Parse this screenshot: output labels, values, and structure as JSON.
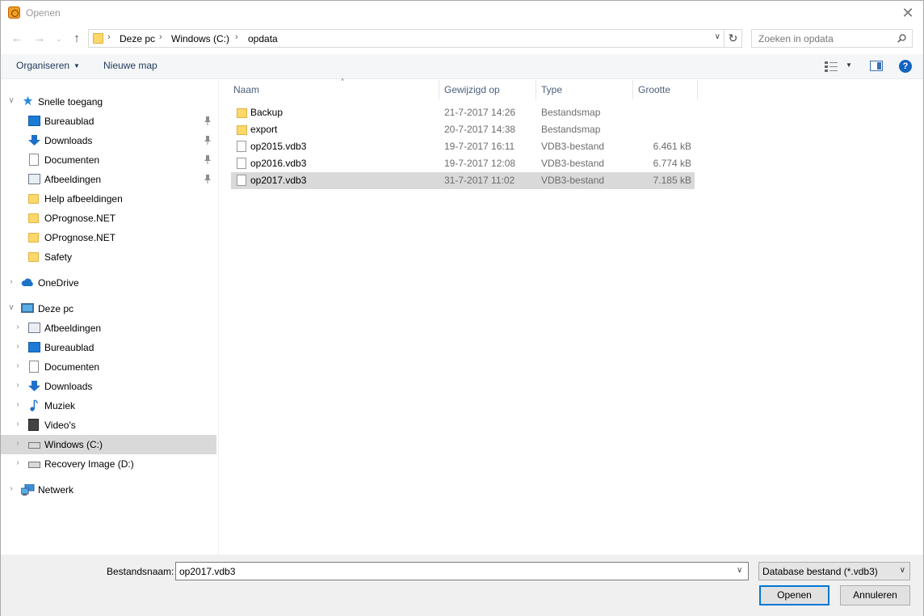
{
  "window": {
    "title": "Openen"
  },
  "address": {
    "crumbs": [
      "Deze pc",
      "Windows (C:)",
      "opdata"
    ]
  },
  "search": {
    "placeholder": "Zoeken in opdata"
  },
  "toolbar": {
    "organize": "Organiseren",
    "new_folder": "Nieuwe map"
  },
  "nav": {
    "items": [
      {
        "label": "Snelle toegang",
        "icon": "star-icon",
        "level": 0,
        "expanded": true
      },
      {
        "label": "Bureaublad",
        "icon": "desktop-icon",
        "level": 1,
        "pinned": true
      },
      {
        "label": "Downloads",
        "icon": "download-icon",
        "level": 1,
        "pinned": true
      },
      {
        "label": "Documenten",
        "icon": "document-icon",
        "level": 1,
        "pinned": true
      },
      {
        "label": "Afbeeldingen",
        "icon": "pictures-icon",
        "level": 1,
        "pinned": true
      },
      {
        "label": "Help afbeeldingen",
        "icon": "folder-icon",
        "level": 1
      },
      {
        "label": "OPrognose.NET",
        "icon": "folder-icon",
        "level": 1
      },
      {
        "label": "OPrognose.NET",
        "icon": "folder-icon",
        "level": 1
      },
      {
        "label": "Safety",
        "icon": "folder-icon",
        "level": 1
      },
      {
        "label": "OneDrive",
        "icon": "cloud-icon",
        "level": 0,
        "expanded": false
      },
      {
        "label": "Deze pc",
        "icon": "computer-icon",
        "level": 0,
        "expanded": true
      },
      {
        "label": "Afbeeldingen",
        "icon": "pictures-icon",
        "level": 1
      },
      {
        "label": "Bureaublad",
        "icon": "desktop-icon",
        "level": 1
      },
      {
        "label": "Documenten",
        "icon": "document-icon",
        "level": 1
      },
      {
        "label": "Downloads",
        "icon": "download-icon",
        "level": 1
      },
      {
        "label": "Muziek",
        "icon": "music-icon",
        "level": 1
      },
      {
        "label": "Video's",
        "icon": "video-icon",
        "level": 1
      },
      {
        "label": "Windows (C:)",
        "icon": "drive-icon",
        "level": 1,
        "selected": true
      },
      {
        "label": "Recovery Image (D:)",
        "icon": "drive-icon",
        "level": 1
      },
      {
        "label": "Netwerk",
        "icon": "network-icon",
        "level": 0,
        "expanded": false
      }
    ]
  },
  "columns": {
    "name": "Naam",
    "modified": "Gewijzigd op",
    "type": "Type",
    "size": "Grootte"
  },
  "files": [
    {
      "name": "Backup",
      "modified": "21-7-2017 14:26",
      "type": "Bestandsmap",
      "size": "",
      "kind": "folder"
    },
    {
      "name": "export",
      "modified": "20-7-2017 14:38",
      "type": "Bestandsmap",
      "size": "",
      "kind": "folder"
    },
    {
      "name": "op2015.vdb3",
      "modified": "19-7-2017 16:11",
      "type": "VDB3-bestand",
      "size": "6.461 kB",
      "kind": "file"
    },
    {
      "name": "op2016.vdb3",
      "modified": "19-7-2017 12:08",
      "type": "VDB3-bestand",
      "size": "6.774 kB",
      "kind": "file"
    },
    {
      "name": "op2017.vdb3",
      "modified": "31-7-2017 11:02",
      "type": "VDB3-bestand",
      "size": "7.185 kB",
      "kind": "file",
      "selected": true
    }
  ],
  "footer": {
    "filename_label": "Bestandsnaam:",
    "filename_value": "op2017.vdb3",
    "filetype": "Database bestand (*.vdb3)",
    "open_label": "Openen",
    "cancel_label": "Annuleren"
  },
  "colors": {
    "accent": "#0078d7",
    "selection": "#d9d9d9",
    "folder": "#fcd86b"
  }
}
